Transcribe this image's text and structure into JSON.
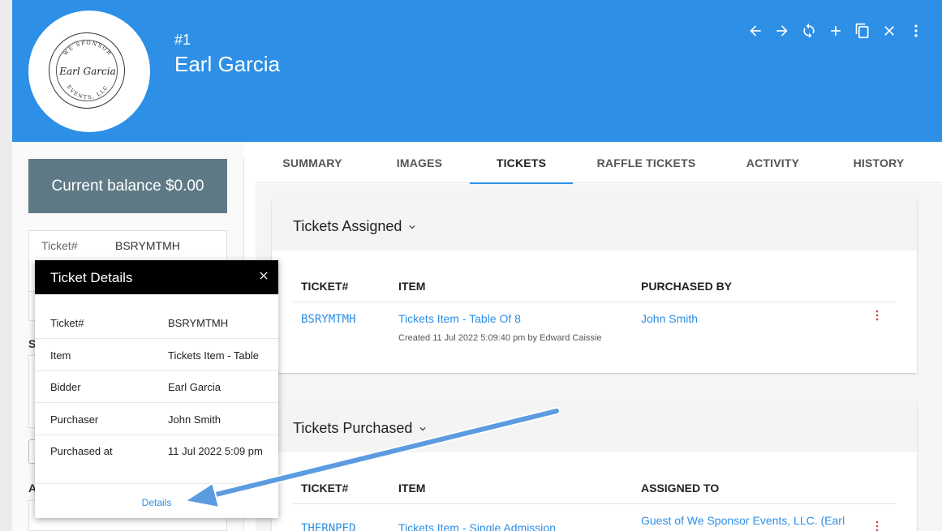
{
  "header": {
    "record_number": "#1",
    "record_name": "Earl Garcia",
    "logo": {
      "top_text": "WE SPONSOR",
      "script_text": "Earl Garcia",
      "bottom_text": "EVENTS, LLC"
    },
    "accent_color": "#2d8fe6",
    "toolbar_icons": [
      "arrow-left-icon",
      "arrow-right-icon",
      "refresh-icon",
      "add-icon",
      "copy-icon",
      "close-icon",
      "more-vert-icon"
    ]
  },
  "left_panel": {
    "balance_label": "Current balance $0.00",
    "ticket_label": "Ticket#",
    "ticket_value": "BSRYMTMH",
    "section_s": "S",
    "section_a": "A"
  },
  "tabs": [
    {
      "label": "SUMMARY",
      "active": false
    },
    {
      "label": "IMAGES",
      "active": false
    },
    {
      "label": "TICKETS",
      "active": true
    },
    {
      "label": "RAFFLE TICKETS",
      "active": false
    },
    {
      "label": "ACTIVITY",
      "active": false
    },
    {
      "label": "HISTORY",
      "active": false
    }
  ],
  "assigned": {
    "title": "Tickets Assigned",
    "headers": [
      "TICKET#",
      "ITEM",
      "PURCHASED BY"
    ],
    "rows": [
      {
        "ticket": "BSRYMTMH",
        "item": "Tickets Item - Table Of 8",
        "created": "Created 11 Jul 2022 5:09:40 pm by Edward Caissie",
        "purchased_by": "John Smith"
      }
    ]
  },
  "purchased": {
    "title": "Tickets Purchased",
    "headers": [
      "TICKET#",
      "ITEM",
      "ASSIGNED TO"
    ],
    "rows": [
      {
        "ticket": "THERNPED",
        "item": "Tickets Item - Single Admission",
        "assigned_to": "Guest of We Sponsor Events, LLC. (Earl"
      }
    ]
  },
  "popup": {
    "title": "Ticket Details",
    "rows": [
      {
        "label": "Ticket#",
        "value": "BSRYMTMH"
      },
      {
        "label": "Item",
        "value": "Tickets Item - Table"
      },
      {
        "label": "Bidder",
        "value": "Earl Garcia"
      },
      {
        "label": "Purchaser",
        "value": "John Smith"
      },
      {
        "label": "Purchased at",
        "value": "11 Jul 2022 5:09 pm"
      }
    ],
    "details_link": "Details"
  }
}
